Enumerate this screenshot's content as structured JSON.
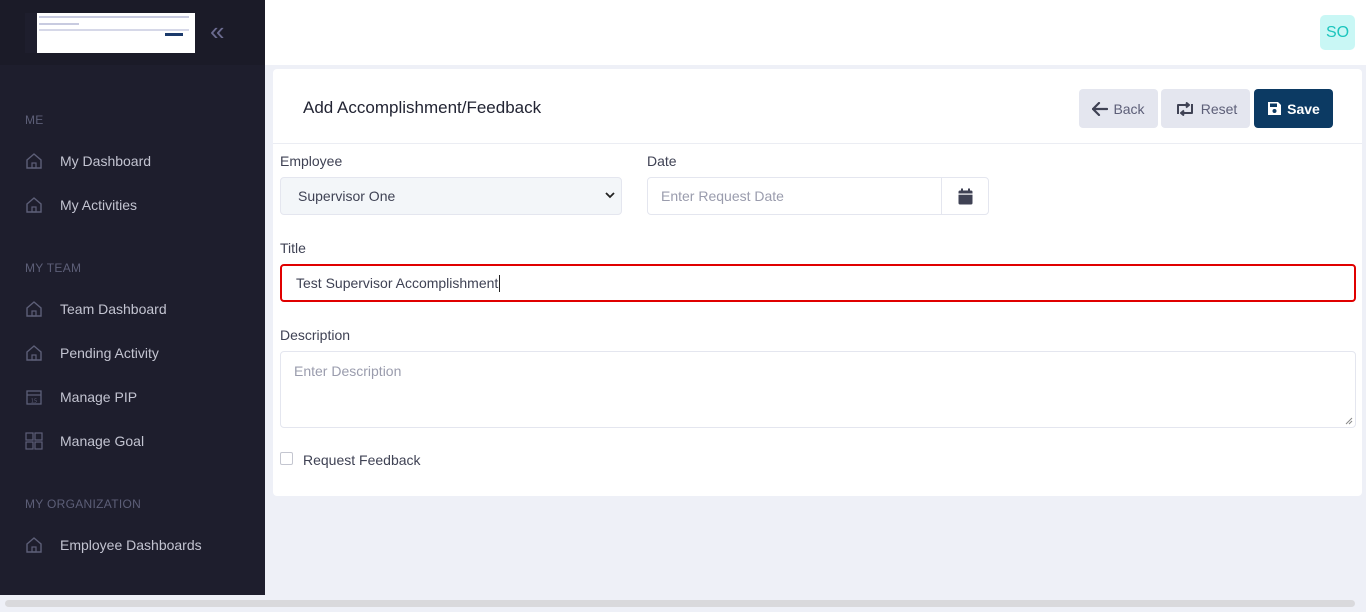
{
  "sidebar": {
    "sections": {
      "me": "ME",
      "my_team": "MY TEAM",
      "my_organization": "MY ORGANIZATION"
    },
    "items": {
      "my_dashboard": "My Dashboard",
      "my_activities": "My Activities",
      "team_dashboard": "Team Dashboard",
      "pending_activity": "Pending Activity",
      "manage_pip": "Manage PIP",
      "manage_goal": "Manage Goal",
      "employee_dashboards": "Employee Dashboards"
    }
  },
  "header": {
    "avatar_initials": "SO"
  },
  "form": {
    "title": "Add Accomplishment/Feedback",
    "buttons": {
      "back": "Back",
      "reset": "Reset",
      "save": "Save"
    },
    "employee_label": "Employee",
    "employee_value": "Supervisor One",
    "date_label": "Date",
    "date_placeholder": "Enter Request Date",
    "title_label": "Title",
    "title_value": "Test Supervisor Accomplishment",
    "description_label": "Description",
    "description_placeholder": "Enter Description",
    "request_feedback_label": "Request Feedback"
  },
  "colors": {
    "sidebar_bg": "#1e1e2d",
    "primary": "#0c3a63",
    "highlight_border": "#e00000",
    "avatar_bg": "#c9f7f5",
    "avatar_fg": "#1bc5bd"
  }
}
